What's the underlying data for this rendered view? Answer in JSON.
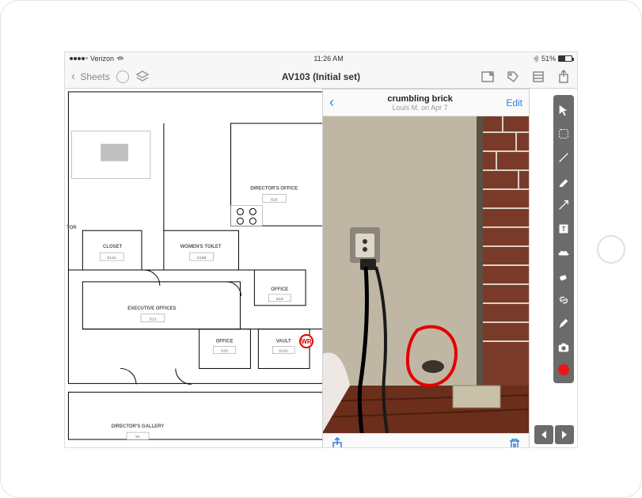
{
  "status": {
    "carrier": "Verizon",
    "time": "11:26 AM",
    "battery_pct": "51%"
  },
  "nav": {
    "back_label": "Sheets",
    "title": "AV103 (Initial set)"
  },
  "floorplan": {
    "rooms": {
      "director_office": {
        "label": "DIRECTOR'S OFFICE",
        "tag": "S16"
      },
      "closet": {
        "label": "CLOSET",
        "tag": "S13A"
      },
      "womens_toilet": {
        "label": "WOMEN'S TOILET",
        "tag": "S13B"
      },
      "executive_offices": {
        "label": "EXECUTIVE OFFICES",
        "tag": "S13"
      },
      "office1": {
        "label": "OFFICE",
        "tag": "S19"
      },
      "office2": {
        "label": "OFFICE",
        "tag": "S20"
      },
      "vault": {
        "label": "VAULT",
        "tag": "S19A"
      },
      "tor": {
        "label": "TOR"
      },
      "director_gallery": {
        "label": "DIRECTOR'S GALLERY",
        "tag": "S1"
      }
    },
    "annotation_wr": "WR"
  },
  "photo_panel": {
    "title": "crumbling brick",
    "subtitle": "Louis M. on Apr 7",
    "edit_label": "Edit"
  },
  "tools": {
    "items": [
      "pointer",
      "marquee",
      "line",
      "marker",
      "arrow",
      "text",
      "cloud",
      "eraser",
      "link",
      "pencil",
      "camera",
      "color"
    ]
  }
}
